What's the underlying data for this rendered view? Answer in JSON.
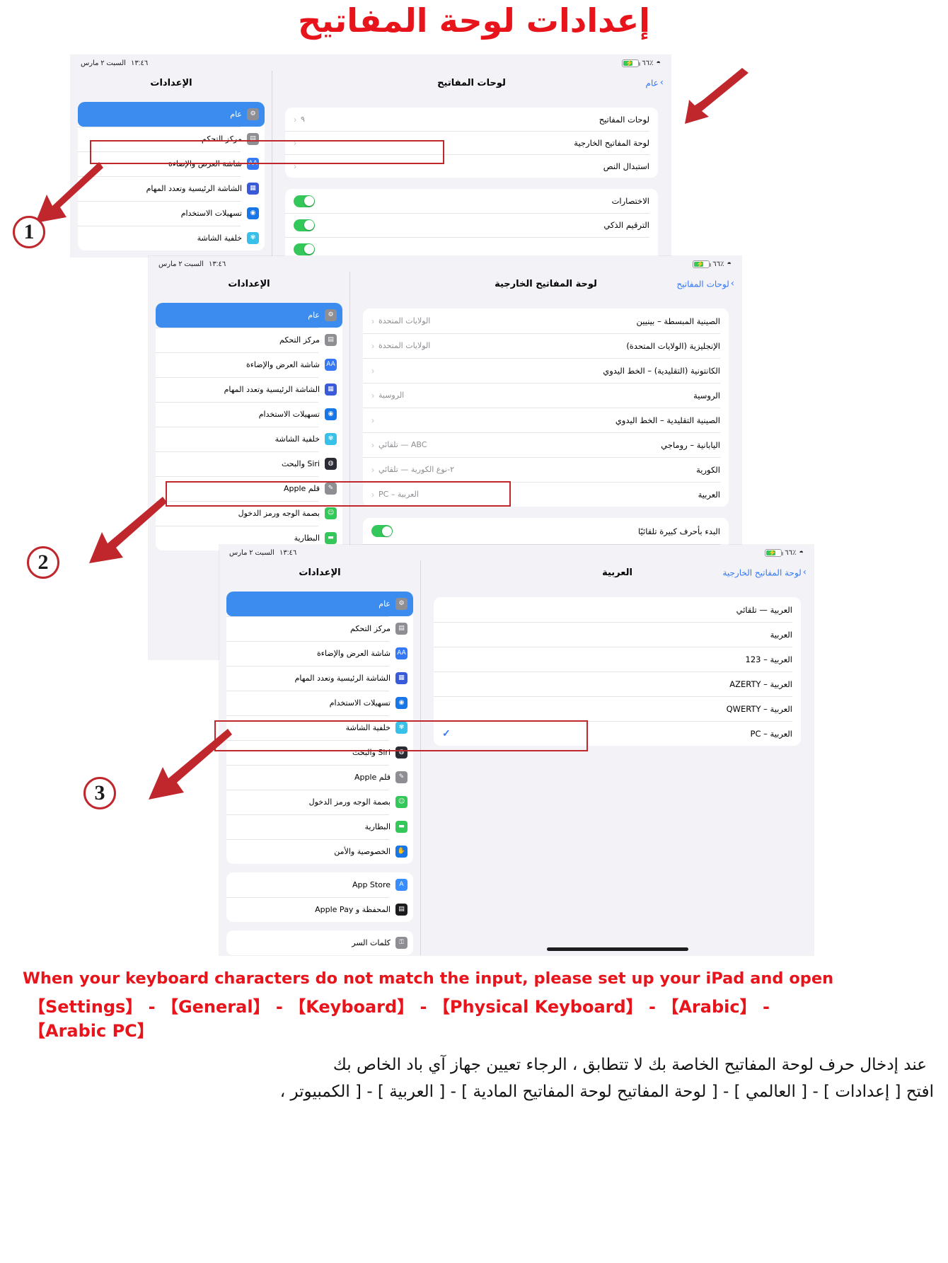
{
  "title": "إعدادات لوحة المفاتيح",
  "status_bar": {
    "time": "١٣:٤٦",
    "date": "السبت ٢ مارس",
    "battery_pct": "٦٦٪",
    "wifi_icon": "wifi-icon",
    "battery_icon": "battery-charging-icon"
  },
  "settings_sidebar": {
    "header": "الإعدادات",
    "items": [
      {
        "label": "عام",
        "icon": "gear-icon",
        "color": "#8e8e93",
        "glyph": "⚙",
        "selected": true
      },
      {
        "label": "مركز التحكم",
        "icon": "control-center-icon",
        "color": "#8e8e93",
        "glyph": "▤",
        "selected": false
      },
      {
        "label": "شاشة العرض والإضاءة",
        "icon": "display-brightness-icon",
        "color": "#3478f6",
        "glyph": "AA",
        "selected": false
      },
      {
        "label": "الشاشة الرئيسية وتعدد المهام",
        "icon": "home-screen-icon",
        "color": "#3a5bd9",
        "glyph": "▦",
        "selected": false
      },
      {
        "label": "تسهيلات الاستخدام",
        "icon": "accessibility-icon",
        "color": "#1777e8",
        "glyph": "◉",
        "selected": false
      },
      {
        "label": "خلفية الشاشة",
        "icon": "wallpaper-icon",
        "color": "#37c0e8",
        "glyph": "✾",
        "selected": false
      },
      {
        "label": "Siri والبحث",
        "icon": "siri-icon",
        "color": "#2b2b33",
        "glyph": "◍",
        "selected": false
      },
      {
        "label": "قلم Apple",
        "icon": "apple-pencil-icon",
        "color": "#8e8e93",
        "glyph": "✎",
        "selected": false
      },
      {
        "label": "بصمة الوجه ورمز الدخول",
        "icon": "face-id-icon",
        "color": "#34c759",
        "glyph": "☺",
        "selected": false
      },
      {
        "label": "البطارية",
        "icon": "battery-icon",
        "color": "#34c759",
        "glyph": "▬",
        "selected": false
      },
      {
        "label": "الخصوصية والأمن",
        "icon": "privacy-hand-icon",
        "color": "#1777e8",
        "glyph": "✋",
        "selected": false
      }
    ],
    "group2": [
      {
        "label": "App Store",
        "icon": "app-store-icon",
        "color": "#3a8dff",
        "glyph": "A"
      },
      {
        "label": "المحفظة و Apple Pay",
        "icon": "wallet-apple-pay-icon",
        "color": "#1c1c1e",
        "glyph": "▤"
      }
    ],
    "group3": [
      {
        "label": "كلمات السر",
        "icon": "passwords-key-icon",
        "color": "#8e8e93",
        "glyph": "⚿"
      }
    ]
  },
  "panel1": {
    "nav_title": "لوحات المفاتيح",
    "back_label": "عام",
    "rows": [
      {
        "label": "لوحات المفاتيح",
        "value": "٩",
        "type": "link"
      },
      {
        "label": "لوحة المفاتيح الخارجية",
        "value": "",
        "type": "link",
        "highlighted": true
      },
      {
        "label": "استبدال النص",
        "value": "",
        "type": "link"
      }
    ],
    "toggles": [
      {
        "label": "الاختصارات",
        "on": true
      },
      {
        "label": "الترقيم الذكي",
        "on": true
      },
      {
        "label": "",
        "on": true
      },
      {
        "label": "",
        "on": true
      },
      {
        "label": "",
        "on": true
      },
      {
        "label": "",
        "on": true
      },
      {
        "label": "",
        "on": true
      },
      {
        "label": "",
        "on": true
      },
      {
        "label": "",
        "on": true
      },
      {
        "label": "",
        "on": true
      },
      {
        "label": "",
        "on": true
      },
      {
        "label": "",
        "on": true
      }
    ]
  },
  "panel2": {
    "nav_title": "لوحة المفاتيح الخارجية",
    "back_label": "لوحات المفاتيح",
    "rows": [
      {
        "label": "الصينية المبسطة – بينيين",
        "value": "الولايات المتحدة"
      },
      {
        "label": "الإنجليزية (الولايات المتحدة)",
        "value": "الولايات المتحدة"
      },
      {
        "label": "الكانتونية (التقليدية) – الخط اليدوي",
        "value": ""
      },
      {
        "label": "الروسية",
        "value": "الروسية"
      },
      {
        "label": "الصينية التقليدية – الخط اليدوي",
        "value": ""
      },
      {
        "label": "اليابانية – روماجي",
        "value": "ABC — تلقائي"
      },
      {
        "label": "الكورية",
        "value": "٢-نوع الكورية — تلقائي"
      },
      {
        "label": "العربية",
        "value": "العربية – PC",
        "highlighted": true
      }
    ],
    "toggles": [
      {
        "label": "البدء بأحرف كبيرة تلقائيًا",
        "on": true
      },
      {
        "label": "",
        "on": true
      },
      {
        "label": "",
        "on": true
      },
      {
        "label": "",
        "on": true
      }
    ]
  },
  "panel3": {
    "nav_title": "العربية",
    "back_label": "لوحة المفاتيح الخارجية",
    "options": [
      {
        "label": "العربية — تلقائي",
        "checked": false
      },
      {
        "label": "العربية",
        "checked": false
      },
      {
        "label": "العربية – 123",
        "checked": false
      },
      {
        "label": "العربية – AZERTY",
        "checked": false
      },
      {
        "label": "العربية – QWERTY",
        "checked": false
      },
      {
        "label": "العربية – PC",
        "checked": true,
        "highlighted": true
      }
    ]
  },
  "steps": [
    "1",
    "2",
    "3"
  ],
  "notes": {
    "english_line1": "When your keyboard characters do not match the input, please set up your iPad and open",
    "english_line2": "【Settings】 - 【General】 - 【Keyboard】 - 【Physical Keyboard】 - 【Arabic】 -",
    "english_line3": "【Arabic PC】",
    "arabic_line1": "عند إدخال حرف لوحة المفاتيح الخاصة بك لا تتطابق ، الرجاء تعيين جهاز آي باد الخاص بك",
    "arabic_line2": "افتح [ إعدادات ] - [ العالمي ] - [ لوحة المفاتيح لوحة المفاتيح المادية ] - [ العربية ] - [ الكمبيوتر ،"
  },
  "colors": {
    "accent_red": "#e8141c",
    "box_red": "#c0272d",
    "ios_blue": "#3478f6",
    "selected_blue": "#3c8cf0",
    "toggle_green": "#34c759"
  }
}
